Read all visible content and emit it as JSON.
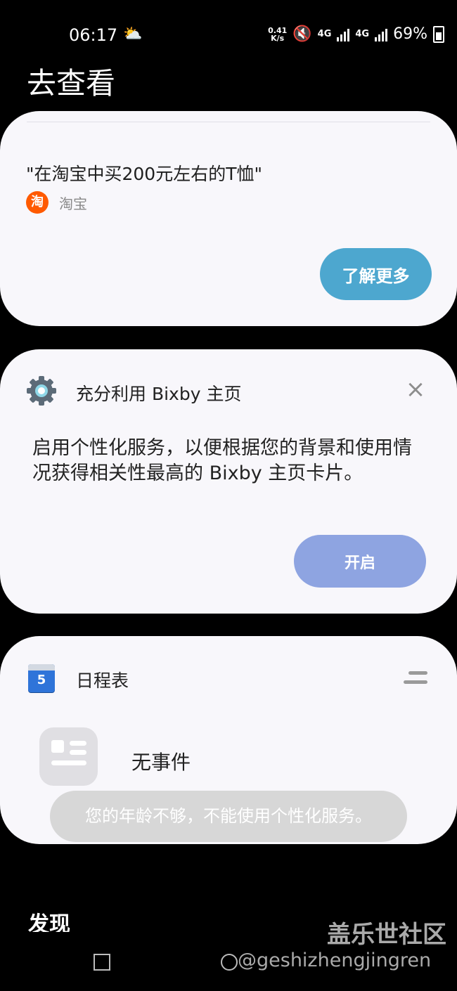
{
  "status": {
    "time": "06:17",
    "network_speed": "0.41\nK/s",
    "net_label_1": "4G",
    "net_label_2": "4G",
    "battery": "69%"
  },
  "page_title": "去查看",
  "cards": {
    "taobao": {
      "query": "\"在淘宝中买200元左右的T恤\"",
      "source": "淘宝",
      "button": "了解更多"
    },
    "bixby": {
      "title": "充分利用 Bixby 主页",
      "body": "启用个性化服务，以便根据您的背景和使用情况获得相关性最高的 Bixby 主页卡片。",
      "button": "开启"
    },
    "calendar": {
      "icon_day": "5",
      "title": "日程表",
      "empty_text": "无事件"
    }
  },
  "toast": "您的年龄不够，不能使用个性化服务。",
  "section_discover": "发现",
  "watermark": "盖乐世社区",
  "handle": "@geshizhengjingren",
  "colors": {
    "background": "#000000",
    "card": "#f8f7fb",
    "learn_more": "#4da7cf",
    "enable": "#8ea4e1"
  },
  "icons": {
    "weather": "sun-cloud-icon",
    "mute": "mute-icon",
    "signal": "signal-bars-icon",
    "battery": "battery-icon",
    "taobao": "taobao-icon",
    "settings": "gear-icon",
    "close": "close-icon",
    "calendar": "calendar-icon",
    "menu": "menu-icon",
    "event": "event-placeholder-icon",
    "recent_apps": "recent-apps-icon",
    "home": "home-icon"
  }
}
